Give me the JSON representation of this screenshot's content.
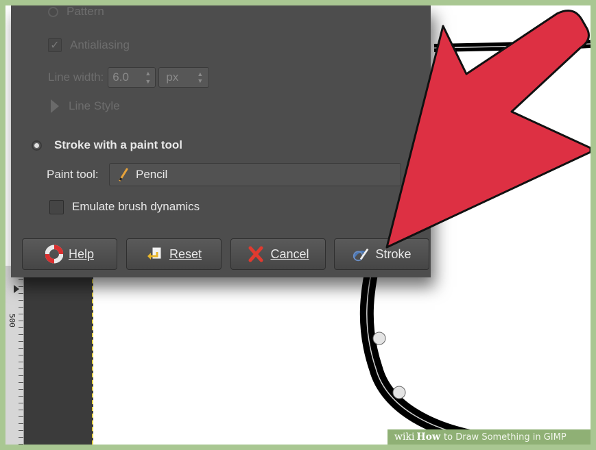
{
  "dialog": {
    "pattern_label": "Pattern",
    "antialiasing_label": "Antialiasing",
    "line_width_label": "Line width:",
    "line_width_value": "6.0",
    "line_width_unit": "px",
    "line_style_label": "Line Style",
    "stroke_paint_tool_label": "Stroke with a paint tool",
    "paint_tool_label": "Paint tool:",
    "paint_tool_value": "Pencil",
    "emulate_label": "Emulate brush dynamics",
    "buttons": {
      "help": "Help",
      "reset": "Reset",
      "cancel": "Cancel",
      "stroke": "Stroke"
    }
  },
  "ruler": {
    "label": "500"
  },
  "watermark": {
    "wiki": "wiki",
    "how": "How",
    "rest": "to Draw Something in GIMP"
  },
  "colors": {
    "arrow": "#dd3043",
    "dialog_bg": "#4d4d4d",
    "frame_border": "#a9c792"
  },
  "icons": [
    "lifebuoy-icon",
    "reset-icon",
    "cancel-x-icon",
    "stroke-brush-icon",
    "pencil-icon",
    "expander-triangle-icon"
  ]
}
